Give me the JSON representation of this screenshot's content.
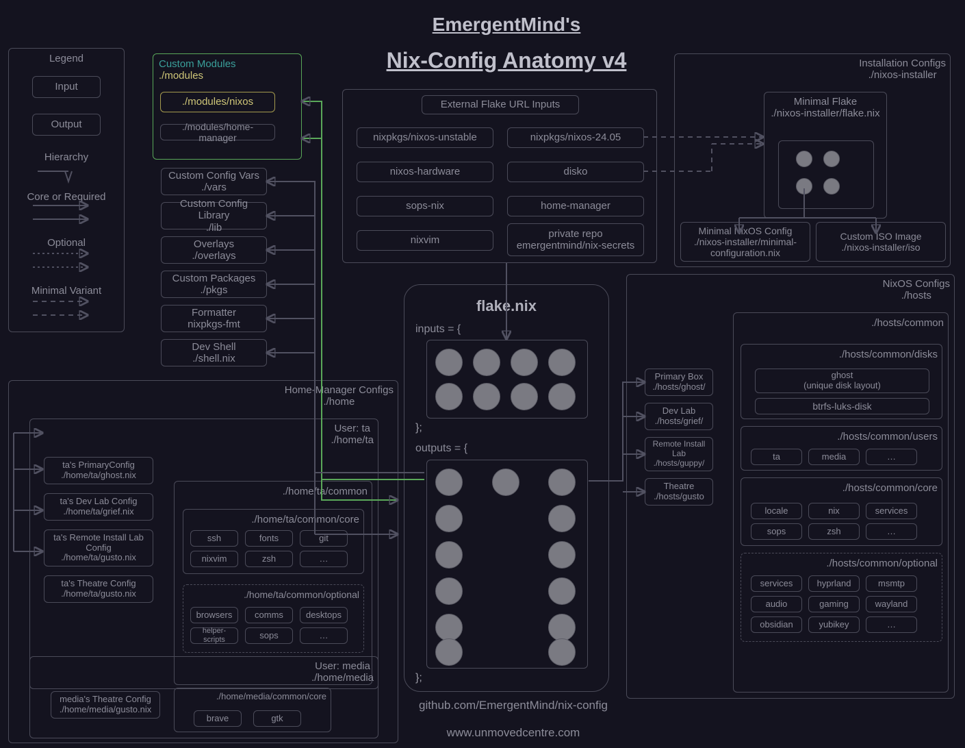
{
  "title1": "EmergentMind's",
  "title2": "Nix-Config Anatomy v4",
  "footer1": "github.com/EmergentMind/nix-config",
  "footer2": "www.unmovedcentre.com",
  "legend": {
    "title": "Legend",
    "input": "Input",
    "output": "Output",
    "hierarchy": "Hierarchy",
    "core": "Core or Required",
    "optional": "Optional",
    "minimal": "Minimal Variant"
  },
  "custom_modules": {
    "title": "Custom Modules",
    "path": "./modules",
    "nixos": "./modules/nixos",
    "hm": "./modules/home-manager"
  },
  "middle_boxes": {
    "vars": {
      "l1": "Custom Config Vars",
      "l2": "./vars"
    },
    "lib": {
      "l1": "Custom Config Library",
      "l2": "./lib"
    },
    "overlays": {
      "l1": "Overlays",
      "l2": "./overlays"
    },
    "pkgs": {
      "l1": "Custom Packages",
      "l2": "./pkgs"
    },
    "fmt": {
      "l1": "Formatter",
      "l2": "nixpkgs-fmt"
    },
    "shell": {
      "l1": "Dev Shell",
      "l2": "./shell.nix"
    }
  },
  "external": {
    "title": "External Flake URL Inputs",
    "items": [
      "nixpkgs/nixos-unstable",
      "nixpkgs/nixos-24.05",
      "nixos-hardware",
      "disko",
      "sops-nix",
      "home-manager",
      "nixvim",
      "private repo\nemergentmind/nix-secrets"
    ]
  },
  "installer": {
    "title": "Installation Configs",
    "path": "./nixos-installer",
    "flake": {
      "l1": "Minimal Flake",
      "l2": "./nixos-installer/flake.nix"
    },
    "min": {
      "l1": "Minimal NixOS Config",
      "l2": "./nixos-installer/minimal-configuration.nix"
    },
    "iso": {
      "l1": "Custom ISO Image",
      "l2": "./nixos-installer/iso"
    }
  },
  "flake": {
    "title": "flake.nix",
    "inputs": "inputs = {",
    "outputs": "outputs = {",
    "close": "};"
  },
  "hosts_side": [
    {
      "l1": "Primary Box",
      "l2": "./hosts/ghost/"
    },
    {
      "l1": "Dev Lab",
      "l2": "./hosts/grief/"
    },
    {
      "l1": "Remote Install Lab",
      "l2": "./hosts/guppy/"
    },
    {
      "l1": "Theatre",
      "l2": "./hosts/gusto"
    }
  ],
  "nixos_configs": {
    "title": "NixOS Configs",
    "path": "./hosts",
    "common": "./hosts/common",
    "disks": {
      "title": "./hosts/common/disks",
      "ghost": {
        "l1": "ghost",
        "l2": "(unique disk layout)"
      },
      "btrfs": "btrfs-luks-disk"
    },
    "users": {
      "title": "./hosts/common/users",
      "items": [
        "ta",
        "media",
        "…"
      ]
    },
    "core": {
      "title": "./hosts/common/core",
      "items": [
        "locale",
        "nix",
        "services",
        "sops",
        "zsh",
        "…"
      ]
    },
    "optional": {
      "title": "./hosts/common/optional",
      "items": [
        "services",
        "hyprland",
        "msmtp",
        "audio",
        "gaming",
        "wayland",
        "obsidian",
        "yubikey",
        "…"
      ]
    }
  },
  "hm_configs": {
    "title": "Home-Manager Configs",
    "path": "./home",
    "user_ta": {
      "l1": "User: ta",
      "l2": "./home/ta"
    },
    "user_media": {
      "l1": "User: media",
      "l2": "./home/media"
    },
    "ta_configs": [
      {
        "l1": "ta's PrimaryConfig",
        "l2": "./home/ta/ghost.nix"
      },
      {
        "l1": "ta's Dev Lab Config",
        "l2": "./home/ta/grief.nix"
      },
      {
        "l1": "ta's Remote Install Lab Config",
        "l2": "./home/ta/gusto.nix"
      },
      {
        "l1": "ta's Theatre Config",
        "l2": "./home/ta/gusto.nix"
      }
    ],
    "media_config": {
      "l1": "media's Theatre Config",
      "l2": "./home/media/gusto.nix"
    },
    "ta_common": "./home/ta/common",
    "ta_core": {
      "title": "./home/ta/common/core",
      "items": [
        "ssh",
        "fonts",
        "git",
        "nixvim",
        "zsh",
        "…"
      ]
    },
    "ta_opt": {
      "title": "./home/ta/common/optional",
      "items": [
        "browsers",
        "comms",
        "desktops",
        "helper-scripts",
        "sops",
        "…"
      ]
    },
    "media_core": {
      "title": "./home/media/common/core",
      "items": [
        "brave",
        "gtk"
      ]
    }
  }
}
